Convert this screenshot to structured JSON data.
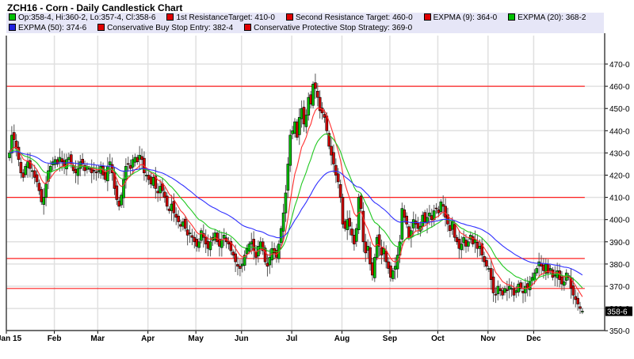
{
  "title": "ZCH16 - Corn - Daily Candlestick Chart",
  "legend": {
    "row1": [
      {
        "label": "Op:358-4, Hi:360-2, Lo:357-4, Cl:358-6",
        "color": "#00c000"
      },
      {
        "label": "1st ResistanceTarget: 410-0",
        "color": "#e00000"
      },
      {
        "label": "Second Resistance Target: 460-0",
        "color": "#e00000"
      },
      {
        "label": "EXPMA (9): 364-0",
        "color": "#e00000"
      },
      {
        "label": "EXPMA (20): 368-2",
        "color": "#00c000"
      }
    ],
    "row2": [
      {
        "label": "EXPMA (50): 374-6",
        "color": "#2020e0"
      },
      {
        "label": "Conservative Buy Stop Entry: 382-4",
        "color": "#e00000"
      },
      {
        "label": "Conservative Protective Stop Strategy: 369-0",
        "color": "#e00000"
      }
    ]
  },
  "chart_data": {
    "type": "candlestick",
    "title": "ZCH16 - Corn - Daily Candlestick Chart",
    "ylim": [
      350,
      475
    ],
    "y_ticks": [
      "350-0",
      "360-0",
      "370-0",
      "380-0",
      "390-0",
      "400-0",
      "410-0",
      "420-0",
      "430-0",
      "440-0",
      "450-0",
      "460-0",
      "470-0"
    ],
    "x_ticks": [
      "Jan 15",
      "Feb",
      "Mar",
      "Apr",
      "May",
      "Jun",
      "Jul",
      "Aug",
      "Sep",
      "Oct",
      "Nov",
      "Dec"
    ],
    "month_trading_days": [
      20,
      19,
      22,
      21,
      20,
      22,
      22,
      21,
      21,
      22,
      20,
      22
    ],
    "grid": true,
    "last_price_label": "358-6",
    "last_candle": {
      "open": 358.5,
      "high": 360.25,
      "low": 357.5,
      "close": 358.75
    },
    "closes": [
      430,
      438,
      436,
      432,
      427,
      421,
      419,
      424,
      426,
      423,
      422,
      419,
      417,
      413,
      408,
      410,
      416,
      422,
      424,
      426,
      427,
      425,
      428,
      426,
      424,
      427,
      428,
      425,
      422,
      421,
      423,
      426,
      425,
      422,
      424,
      423,
      421,
      422,
      421,
      422,
      424,
      420,
      418,
      424,
      426,
      421,
      414,
      409,
      406,
      411,
      418,
      424,
      425,
      423,
      427,
      428,
      426,
      429,
      427,
      421,
      420,
      418,
      416,
      419,
      414,
      412,
      415,
      413,
      410,
      406,
      404,
      407,
      403,
      401,
      399,
      397,
      399,
      396,
      393,
      394,
      392,
      390,
      388,
      390,
      395,
      392,
      389,
      387,
      390,
      392,
      394,
      390,
      388,
      391,
      393,
      390,
      389,
      386,
      384,
      381,
      379,
      378,
      380,
      384,
      387,
      389,
      390,
      386,
      383,
      388,
      390,
      386,
      381,
      379,
      383,
      387,
      385,
      383,
      389,
      396,
      403,
      412,
      425,
      438,
      440,
      444,
      437,
      446,
      450,
      443,
      447,
      455,
      452,
      461,
      459,
      455,
      449,
      448,
      446,
      440,
      433,
      429,
      425,
      420,
      417,
      410,
      398,
      396,
      400,
      397,
      393,
      389,
      396,
      410,
      405,
      390,
      385,
      388,
      380,
      375,
      383,
      392,
      388,
      384,
      387,
      381,
      378,
      374,
      377,
      379,
      384,
      390,
      405,
      401,
      398,
      392,
      395,
      400,
      398,
      396,
      397,
      402,
      399,
      401,
      403,
      400,
      404,
      405,
      403,
      408,
      406,
      401,
      398,
      395,
      399,
      392,
      390,
      387,
      389,
      392,
      388,
      390,
      393,
      389,
      391,
      387,
      388,
      384,
      381,
      379,
      378,
      373,
      367,
      366,
      370,
      368,
      366,
      369,
      368,
      370,
      369,
      366,
      368,
      371,
      369,
      367,
      370,
      369,
      372,
      374,
      376,
      378,
      381,
      379,
      377,
      380,
      376,
      378,
      374,
      375,
      377,
      373,
      371,
      372,
      376,
      374,
      369,
      366,
      364,
      362,
      360,
      358.75
    ],
    "indicators": [
      {
        "name": "EXPMA (9)",
        "period": 9,
        "color": "#ff3030"
      },
      {
        "name": "EXPMA (20)",
        "period": 20,
        "color": "#20c820"
      },
      {
        "name": "EXPMA (50)",
        "period": 50,
        "color": "#3030ff"
      }
    ],
    "horizontal_lines": [
      {
        "name": "Second Resistance Target",
        "value": 460,
        "color": "#ff2020"
      },
      {
        "name": "1st ResistanceTarget",
        "value": 410,
        "color": "#ff2020"
      },
      {
        "name": "Conservative Buy Stop Entry",
        "value": 382.5,
        "color": "#ff2020"
      },
      {
        "name": "Conservative Protective Stop Strategy",
        "value": 369,
        "color": "#ff2020"
      }
    ],
    "colors": {
      "up": "#00c000",
      "down": "#d00000"
    }
  }
}
